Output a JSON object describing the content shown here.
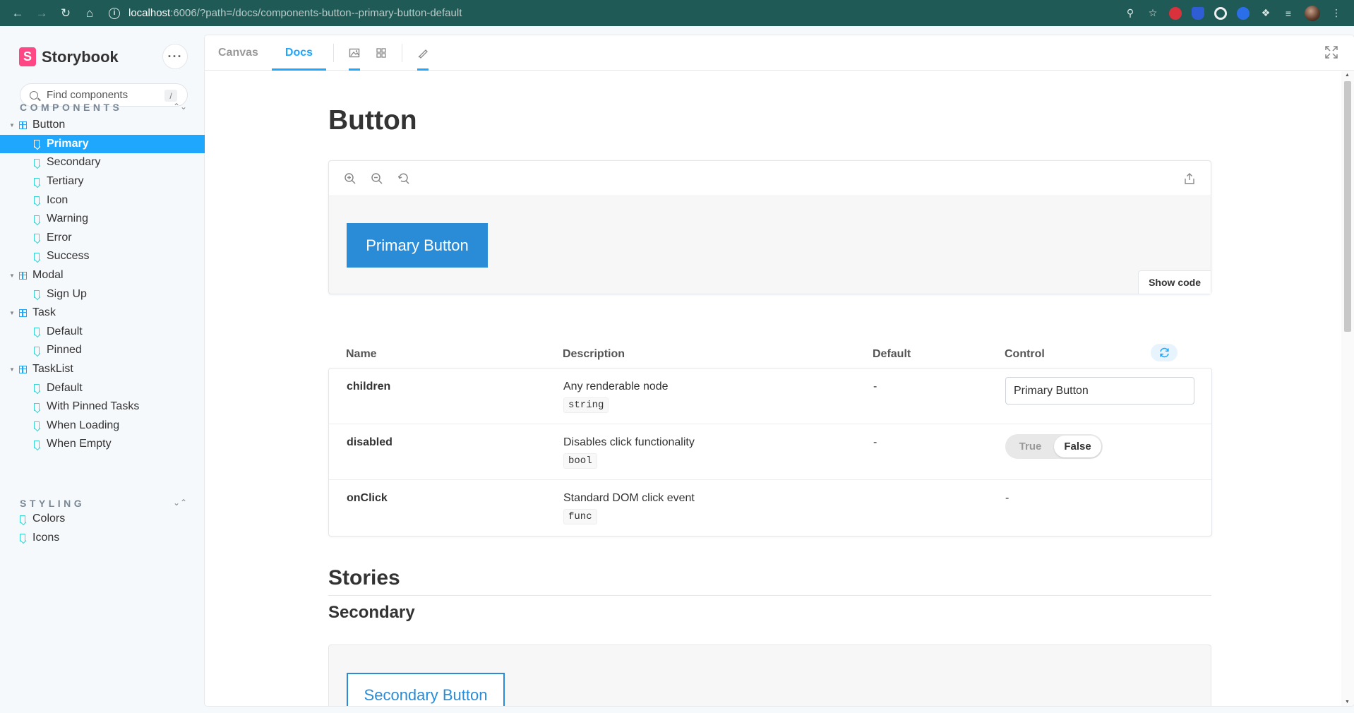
{
  "browser": {
    "url_host": "localhost",
    "url_path": ":6006/?path=/docs/components-button--primary-button-default",
    "icons": [
      "back-icon",
      "forward-icon",
      "reload-icon",
      "home-icon",
      "info-icon",
      "zoom-icon",
      "star-icon",
      "extensions-icon",
      "menu-icon"
    ]
  },
  "sidebar": {
    "brand": "Storybook",
    "search_placeholder": "Find components",
    "search_shortcut": "/",
    "components_heading": "COMPONENTS",
    "styling_heading": "STYLING",
    "tree": [
      {
        "label": "Button",
        "type": "component"
      },
      {
        "label": "Primary",
        "type": "story",
        "selected": true
      },
      {
        "label": "Secondary",
        "type": "story"
      },
      {
        "label": "Tertiary",
        "type": "story"
      },
      {
        "label": "Icon",
        "type": "story"
      },
      {
        "label": "Warning",
        "type": "story"
      },
      {
        "label": "Error",
        "type": "story"
      },
      {
        "label": "Success",
        "type": "story"
      },
      {
        "label": "Modal",
        "type": "component"
      },
      {
        "label": "Sign Up",
        "type": "story"
      },
      {
        "label": "Task",
        "type": "component"
      },
      {
        "label": "Default",
        "type": "story"
      },
      {
        "label": "Pinned",
        "type": "story"
      },
      {
        "label": "TaskList",
        "type": "component"
      },
      {
        "label": "Default",
        "type": "story"
      },
      {
        "label": "With Pinned Tasks",
        "type": "story"
      },
      {
        "label": "When Loading",
        "type": "story"
      },
      {
        "label": "When Empty",
        "type": "story"
      }
    ],
    "styling": [
      {
        "label": "Colors"
      },
      {
        "label": "Icons"
      }
    ]
  },
  "toolbar": {
    "tab_canvas": "Canvas",
    "tab_docs": "Docs"
  },
  "doc": {
    "title": "Button",
    "primary_button_label": "Primary Button",
    "show_code": "Show code",
    "props_headers": {
      "name": "Name",
      "description": "Description",
      "default": "Default",
      "control": "Control"
    },
    "props": [
      {
        "name": "children",
        "description": "Any renderable node",
        "type": "string",
        "default": "-",
        "control_value": "Primary Button"
      },
      {
        "name": "disabled",
        "description": "Disables click functionality",
        "type": "bool",
        "default": "-",
        "toggle_true": "True",
        "toggle_false": "False"
      },
      {
        "name": "onClick",
        "description": "Standard DOM click event",
        "type": "func",
        "control": "-"
      }
    ],
    "stories_heading": "Stories",
    "secondary_heading": "Secondary",
    "secondary_button_label": "Secondary Button"
  },
  "colors": {
    "accent": "#1ea7fd",
    "brand": "#ff4785",
    "button_primary": "#2a8bd6",
    "chrome_bar": "#1f5a56"
  }
}
